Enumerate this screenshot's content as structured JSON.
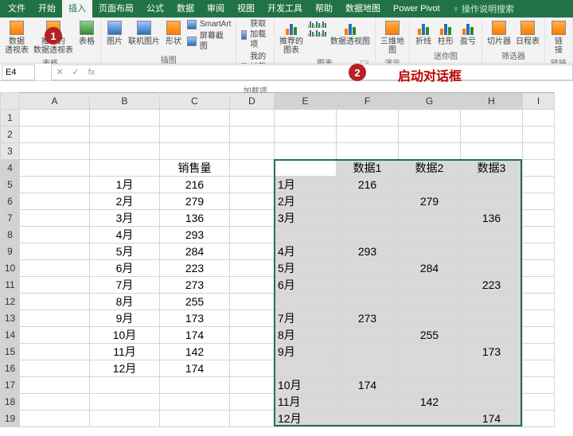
{
  "menu": {
    "items": [
      "文件",
      "开始",
      "插入",
      "页面布局",
      "公式",
      "数据",
      "审阅",
      "视图",
      "开发工具",
      "帮助",
      "数据地图",
      "Power Pivot"
    ],
    "active_index": 2,
    "tellme": "操作说明搜索"
  },
  "ribbon": {
    "groups": [
      {
        "label": "表格",
        "items": [
          {
            "name": "pivot-table",
            "label": "数据\n透视表"
          },
          {
            "name": "recommended-pivot",
            "label": "推荐的\n数据透视表"
          },
          {
            "name": "table",
            "label": "表格"
          }
        ]
      },
      {
        "label": "插图",
        "items": [
          {
            "name": "pictures",
            "label": "图片"
          },
          {
            "name": "online-pictures",
            "label": "联机图片"
          },
          {
            "name": "shapes",
            "label": "形状"
          }
        ],
        "small": [
          {
            "name": "smartart",
            "label": "SmartArt"
          },
          {
            "name": "screenshot",
            "label": "屏幕截图"
          }
        ]
      },
      {
        "label": "加载项",
        "small": [
          {
            "name": "get-addins",
            "label": "获取加载项"
          },
          {
            "name": "my-addins",
            "label": "我的加载项"
          }
        ]
      },
      {
        "label": "图表",
        "items": [
          {
            "name": "recommended-charts",
            "label": "推荐的\n图表"
          },
          {
            "name": "charts-gallery",
            "label": ""
          },
          {
            "name": "pivot-chart",
            "label": "数据透视图"
          }
        ],
        "launcher": true
      },
      {
        "label": "演示",
        "items": [
          {
            "name": "3d-map",
            "label": "三维地\n图"
          }
        ]
      },
      {
        "label": "迷你图",
        "items": [
          {
            "name": "sparkline-line",
            "label": "折线"
          },
          {
            "name": "sparkline-column",
            "label": "柱形"
          },
          {
            "name": "sparkline-winloss",
            "label": "盈亏"
          }
        ]
      },
      {
        "label": "筛选器",
        "items": [
          {
            "name": "slicer",
            "label": "切片器"
          },
          {
            "name": "timeline",
            "label": "日程表"
          }
        ]
      },
      {
        "label": "链接",
        "items": [
          {
            "name": "link",
            "label": "链\n接"
          }
        ]
      }
    ]
  },
  "badges": {
    "1": "1",
    "2": "2"
  },
  "namebox": "E4",
  "fx": {
    "cancel": "✕",
    "enter": "✓",
    "fx": "fx"
  },
  "callout": "启动对话框",
  "columns": [
    "A",
    "B",
    "C",
    "D",
    "E",
    "F",
    "G",
    "H",
    "I"
  ],
  "headerBC": {
    "c": "销售量"
  },
  "bc": [
    {
      "b": "1月",
      "c": "216"
    },
    {
      "b": "2月",
      "c": "279"
    },
    {
      "b": "3月",
      "c": "136"
    },
    {
      "b": "4月",
      "c": "293"
    },
    {
      "b": "5月",
      "c": "284"
    },
    {
      "b": "6月",
      "c": "223"
    },
    {
      "b": "7月",
      "c": "273"
    },
    {
      "b": "8月",
      "c": "255"
    },
    {
      "b": "9月",
      "c": "173"
    },
    {
      "b": "10月",
      "c": "174"
    },
    {
      "b": "11月",
      "c": "142"
    },
    {
      "b": "12月",
      "c": "174"
    }
  ],
  "efghHeader": {
    "f": "数据1",
    "g": "数据2",
    "h": "数据3"
  },
  "efgh": [
    {
      "r": 5,
      "e": "1月",
      "f": "216",
      "g": "",
      "h": ""
    },
    {
      "r": 6,
      "e": "2月",
      "f": "",
      "g": "279",
      "h": ""
    },
    {
      "r": 7,
      "e": "3月",
      "f": "",
      "g": "",
      "h": "136"
    },
    {
      "r": 8,
      "e": "",
      "f": "",
      "g": "",
      "h": ""
    },
    {
      "r": 9,
      "e": "4月",
      "f": "293",
      "g": "",
      "h": ""
    },
    {
      "r": 10,
      "e": "5月",
      "f": "",
      "g": "284",
      "h": ""
    },
    {
      "r": 11,
      "e": "6月",
      "f": "",
      "g": "",
      "h": "223"
    },
    {
      "r": 12,
      "e": "",
      "f": "",
      "g": "",
      "h": ""
    },
    {
      "r": 13,
      "e": "7月",
      "f": "273",
      "g": "",
      "h": ""
    },
    {
      "r": 14,
      "e": "8月",
      "f": "",
      "g": "255",
      "h": ""
    },
    {
      "r": 15,
      "e": "9月",
      "f": "",
      "g": "",
      "h": "173"
    },
    {
      "r": 16,
      "e": "",
      "f": "",
      "g": "",
      "h": ""
    },
    {
      "r": 17,
      "e": "10月",
      "f": "174",
      "g": "",
      "h": ""
    },
    {
      "r": 18,
      "e": "11月",
      "f": "",
      "g": "142",
      "h": ""
    },
    {
      "r": 19,
      "e": "12月",
      "f": "",
      "g": "",
      "h": "174"
    }
  ],
  "chart_data": {
    "type": "table",
    "title": "销售量",
    "categories": [
      "1月",
      "2月",
      "3月",
      "4月",
      "5月",
      "6月",
      "7月",
      "8月",
      "9月",
      "10月",
      "11月",
      "12月"
    ],
    "values": [
      216,
      279,
      136,
      293,
      284,
      223,
      273,
      255,
      173,
      174,
      142,
      174
    ],
    "series": [
      {
        "name": "数据1",
        "values": [
          216,
          null,
          null,
          293,
          null,
          null,
          273,
          null,
          null,
          174,
          null,
          null
        ]
      },
      {
        "name": "数据2",
        "values": [
          null,
          279,
          null,
          null,
          284,
          null,
          null,
          255,
          null,
          null,
          142,
          null
        ]
      },
      {
        "name": "数据3",
        "values": [
          null,
          null,
          136,
          null,
          null,
          223,
          null,
          null,
          173,
          null,
          null,
          174
        ]
      }
    ]
  }
}
